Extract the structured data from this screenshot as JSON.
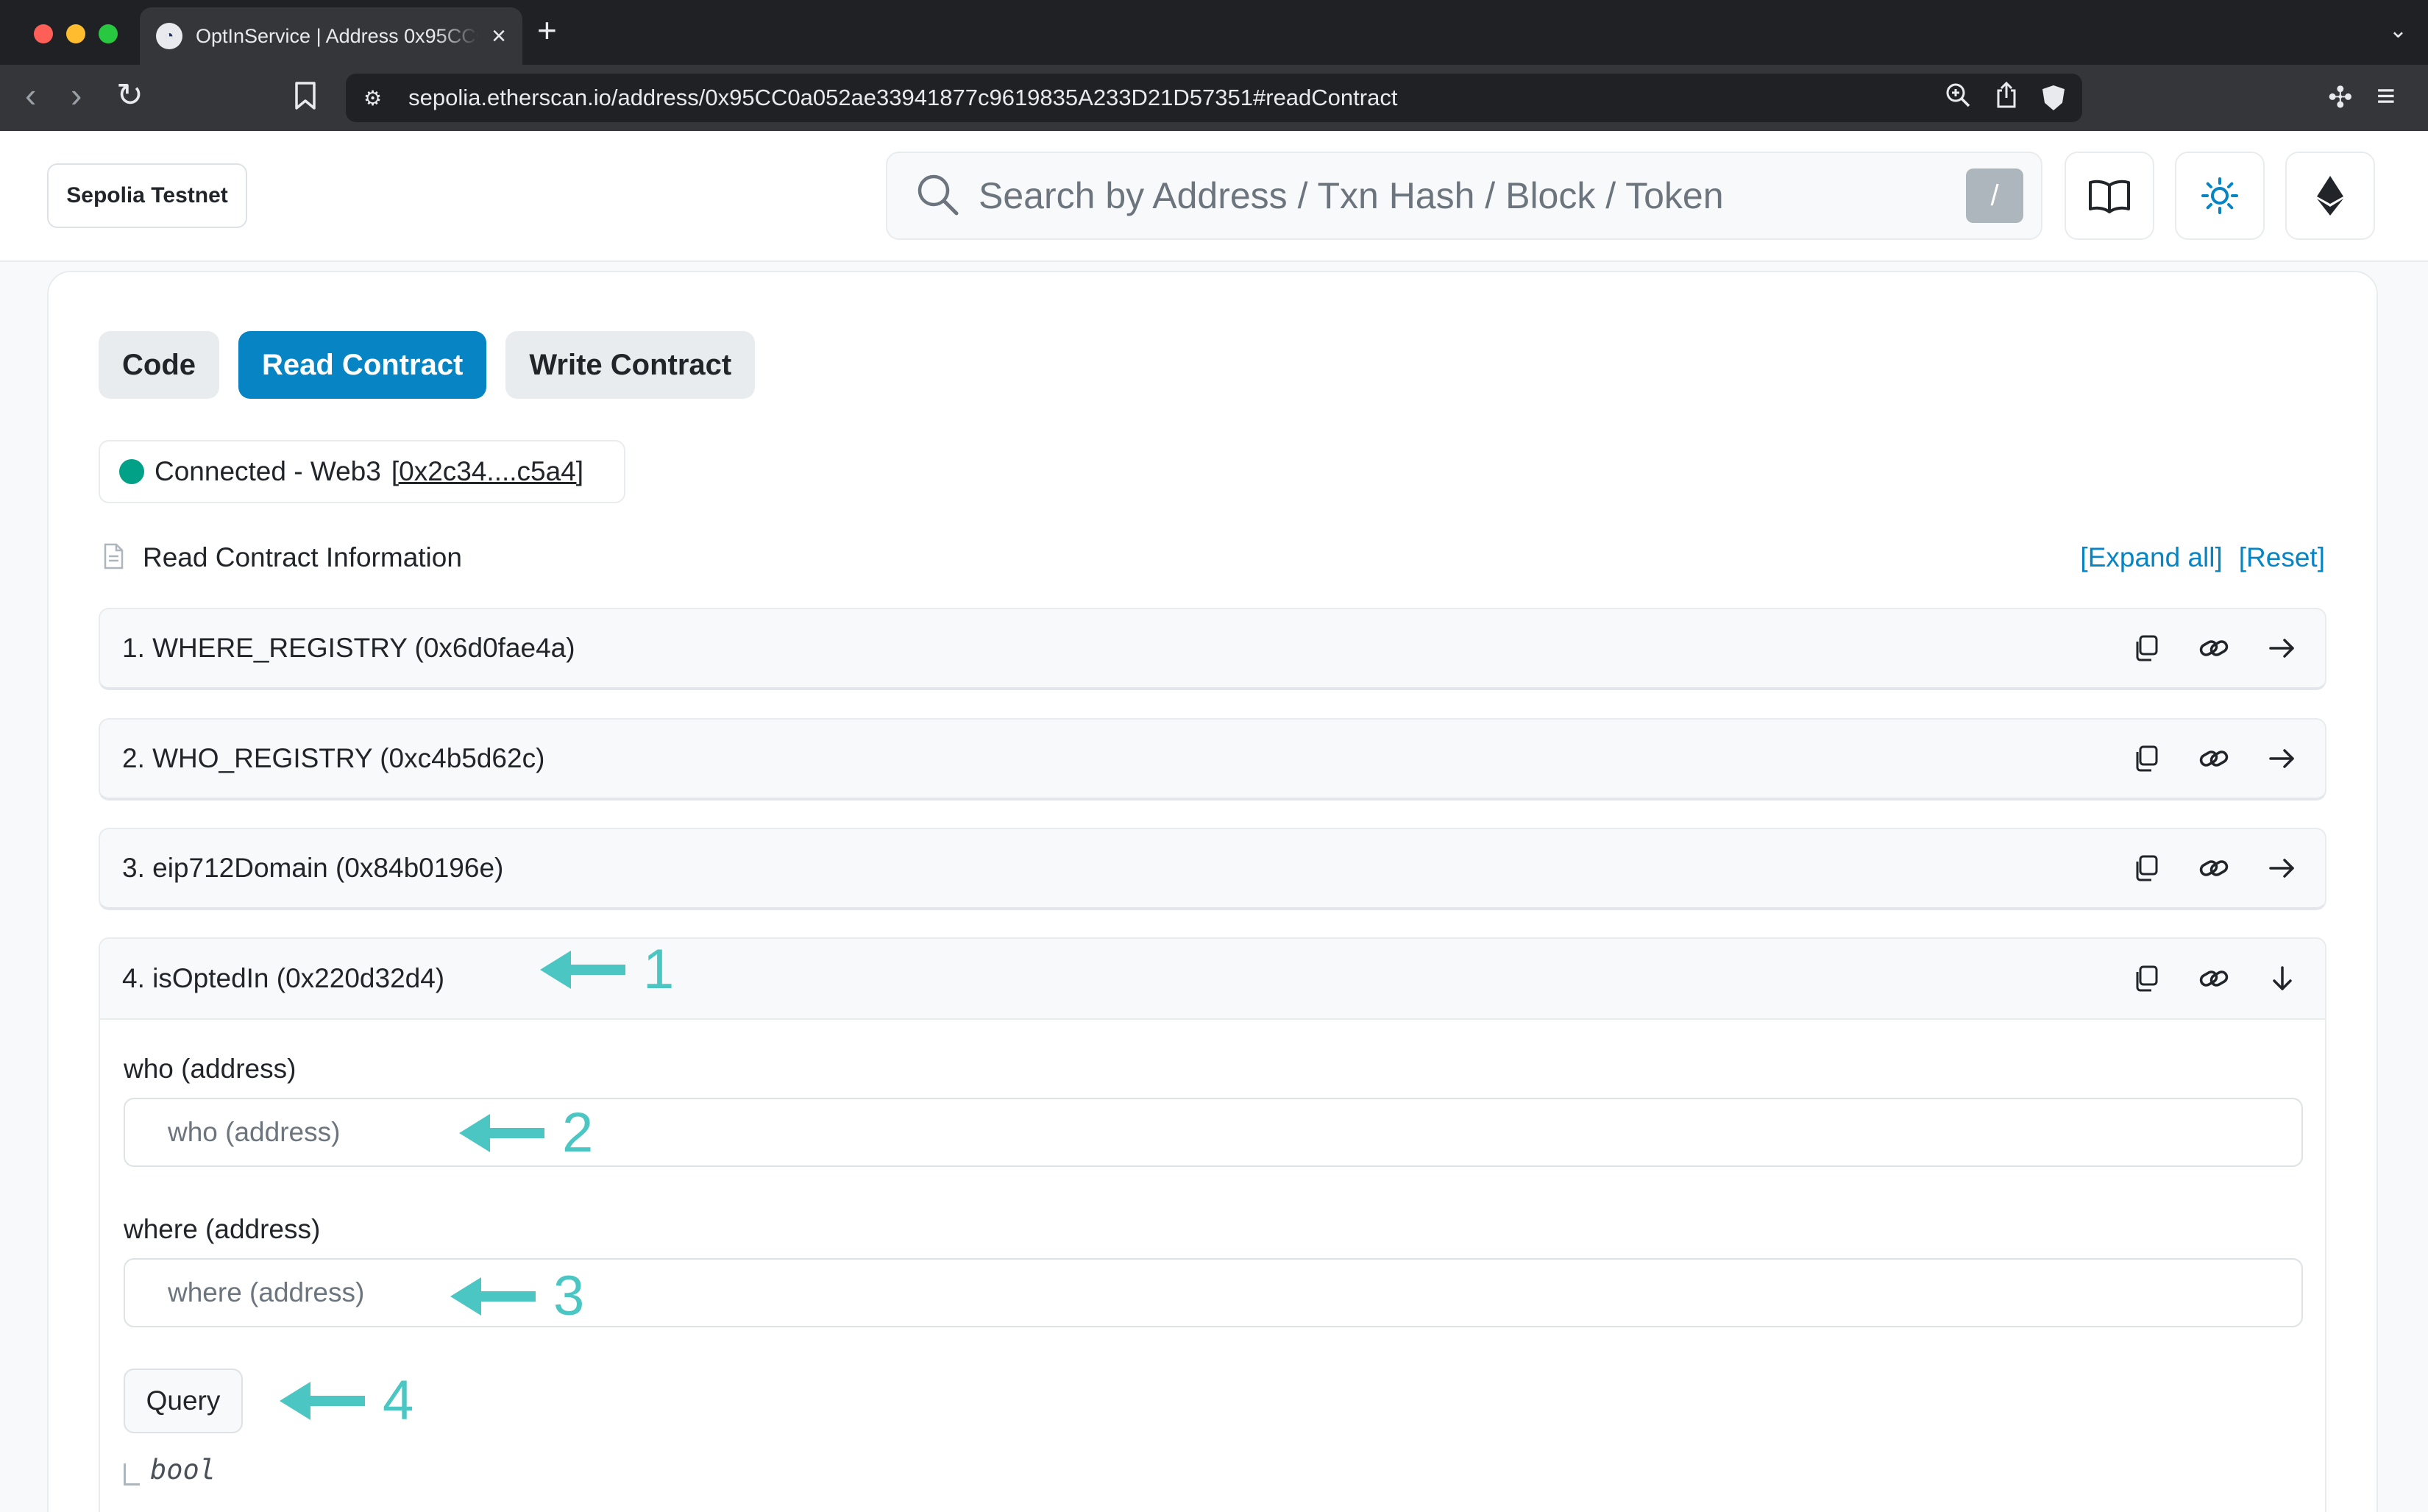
{
  "browser": {
    "tab_title": "OptInService | Address 0x95CC0a052ae33941877c9619835A233D21D57351",
    "tab_close": "×",
    "new_tab": "+",
    "url": "sepolia.etherscan.io/address/0x95CC0a052ae33941877c9619835A233D21D57351#readContract"
  },
  "header": {
    "network_label": "Sepolia Testnet",
    "search_placeholder": "Search by Address / Txn Hash / Block / Token",
    "search_shortcut": "/"
  },
  "tabs": [
    {
      "label": "Code",
      "active": false
    },
    {
      "label": "Read Contract",
      "active": true
    },
    {
      "label": "Write Contract",
      "active": false
    }
  ],
  "connection": {
    "status": "Connected - Web3",
    "address": "[0x2c34....c5a4]",
    "status_color": "#00a186"
  },
  "read_contract": {
    "title": "Read Contract Information",
    "expand_all": "[Expand all]",
    "reset": "[Reset]"
  },
  "functions": [
    {
      "label": "1. WHERE_REGISTRY (0x6d0fae4a)",
      "expanded": false
    },
    {
      "label": "2. WHO_REGISTRY (0xc4b5d62c)",
      "expanded": false
    },
    {
      "label": "3. eip712Domain (0x84b0196e)",
      "expanded": false
    },
    {
      "label": "4. isOptedIn (0x220d32d4)",
      "expanded": true
    }
  ],
  "expanded_function": {
    "params": [
      {
        "label": "who (address)",
        "placeholder": "who (address)"
      },
      {
        "label": "where (address)",
        "placeholder": "where (address)"
      }
    ],
    "query_label": "Query",
    "return_type": "bool"
  },
  "annotations": {
    "color": "#4bc6c3",
    "labels": [
      "1",
      "2",
      "3",
      "4"
    ]
  },
  "colors": {
    "accent": "#0784c3",
    "connected": "#00a186"
  }
}
